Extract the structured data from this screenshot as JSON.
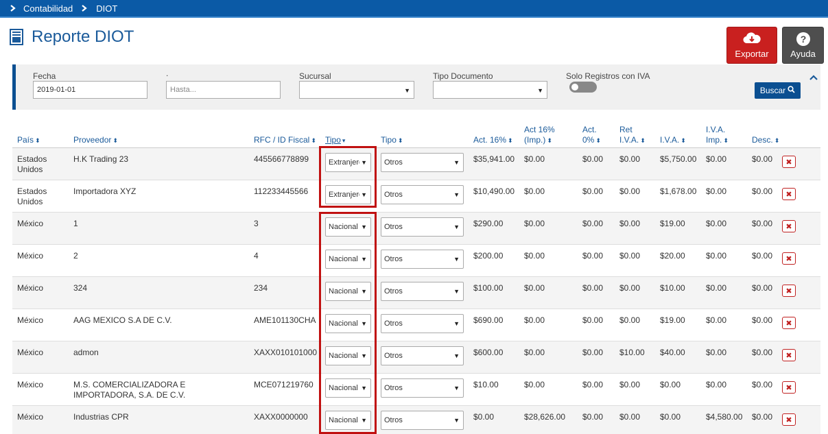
{
  "breadcrumb": {
    "items": [
      "Contabilidad",
      "DIOT"
    ]
  },
  "page": {
    "title": "Reporte DIOT"
  },
  "actions": {
    "export_label": "Exportar",
    "help_label": "Ayuda"
  },
  "filters": {
    "fecha_label": "Fecha",
    "fecha_value": "2019-01-01",
    "hasta_label": ".",
    "hasta_placeholder": "Hasta...",
    "sucursal_label": "Sucursal",
    "tipo_documento_label": "Tipo Documento",
    "solo_iva_label": "Solo Registros con IVA",
    "search_label": "Buscar"
  },
  "table": {
    "columns": [
      "País",
      "Proveedor",
      "RFC / ID Fiscal",
      "Tipo",
      "Tipo",
      "Act. 16%",
      "Act 16% (Imp.)",
      "Act. 0%",
      "Ret I.V.A.",
      "I.V.A.",
      "I.V.A. Imp.",
      "Desc."
    ],
    "rows": [
      {
        "pais": "Estados Unidos",
        "proveedor": "H.K Trading 23",
        "rfc": "445566778899",
        "tipo1": "Extranjero",
        "tipo2": "Otros",
        "act16": "$35,941.00",
        "act16imp": "$0.00",
        "act0": "$0.00",
        "retiva": "$0.00",
        "iva": "$5,750.00",
        "ivaimp": "$0.00",
        "desc": "$0.00"
      },
      {
        "pais": "Estados Unidos",
        "proveedor": "Importadora XYZ",
        "rfc": "112233445566",
        "tipo1": "Extranjero",
        "tipo2": "Otros",
        "act16": "$10,490.00",
        "act16imp": "$0.00",
        "act0": "$0.00",
        "retiva": "$0.00",
        "iva": "$1,678.00",
        "ivaimp": "$0.00",
        "desc": "$0.00"
      },
      {
        "pais": "México",
        "proveedor": "1",
        "rfc": "3",
        "tipo1": "Nacional",
        "tipo2": "Otros",
        "act16": "$290.00",
        "act16imp": "$0.00",
        "act0": "$0.00",
        "retiva": "$0.00",
        "iva": "$19.00",
        "ivaimp": "$0.00",
        "desc": "$0.00"
      },
      {
        "pais": "México",
        "proveedor": "2",
        "rfc": "4",
        "tipo1": "Nacional",
        "tipo2": "Otros",
        "act16": "$200.00",
        "act16imp": "$0.00",
        "act0": "$0.00",
        "retiva": "$0.00",
        "iva": "$20.00",
        "ivaimp": "$0.00",
        "desc": "$0.00"
      },
      {
        "pais": "México",
        "proveedor": "324",
        "rfc": "234",
        "tipo1": "Nacional",
        "tipo2": "Otros",
        "act16": "$100.00",
        "act16imp": "$0.00",
        "act0": "$0.00",
        "retiva": "$0.00",
        "iva": "$10.00",
        "ivaimp": "$0.00",
        "desc": "$0.00"
      },
      {
        "pais": "México",
        "proveedor": "AAG MEXICO S.A DE C.V.",
        "rfc": "AME101130CHA",
        "tipo1": "Nacional",
        "tipo2": "Otros",
        "act16": "$690.00",
        "act16imp": "$0.00",
        "act0": "$0.00",
        "retiva": "$0.00",
        "iva": "$19.00",
        "ivaimp": "$0.00",
        "desc": "$0.00"
      },
      {
        "pais": "México",
        "proveedor": "admon",
        "rfc": "XAXX010101000",
        "tipo1": "Nacional",
        "tipo2": "Otros",
        "act16": "$600.00",
        "act16imp": "$0.00",
        "act0": "$0.00",
        "retiva": "$10.00",
        "iva": "$40.00",
        "ivaimp": "$0.00",
        "desc": "$0.00"
      },
      {
        "pais": "México",
        "proveedor": "M.S. COMERCIALIZADORA E IMPORTADORA, S.A. DE C.V.",
        "rfc": "MCE071219760",
        "tipo1": "Nacional",
        "tipo2": "Otros",
        "act16": "$10.00",
        "act16imp": "$0.00",
        "act0": "$0.00",
        "retiva": "$0.00",
        "iva": "$0.00",
        "ivaimp": "$0.00",
        "desc": "$0.00"
      },
      {
        "pais": "México",
        "proveedor": "Industrias CPR",
        "rfc": "XAXX0000000",
        "tipo1": "Nacional",
        "tipo2": "Otros",
        "act16": "$0.00",
        "act16imp": "$28,626.00",
        "act0": "$0.00",
        "retiva": "$0.00",
        "iva": "$0.00",
        "ivaimp": "$4,580.00",
        "desc": "$0.00"
      }
    ]
  },
  "colors": {
    "primary": "#0b5aa6",
    "danger": "#c9201f",
    "highlight": "#c01010"
  }
}
